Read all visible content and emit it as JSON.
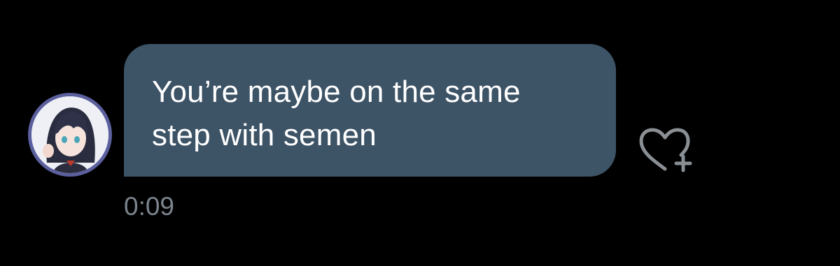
{
  "message": {
    "text": "You’re maybe on the same\nstep with semen",
    "time": "0:09"
  },
  "colors": {
    "background": "#000000",
    "bubble": "#3d5366",
    "avatar_ring": "#5b5f9e",
    "timestamp": "#7c858e",
    "icon": "#8a8f94"
  },
  "icons": {
    "reaction": "heart-plus-icon"
  }
}
